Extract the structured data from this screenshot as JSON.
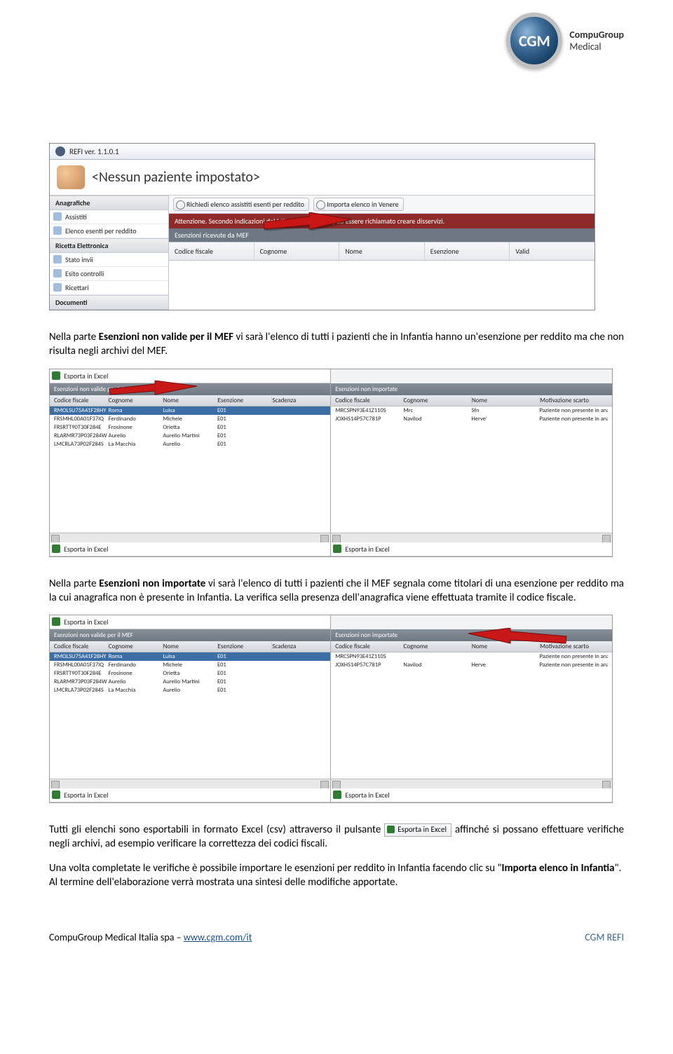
{
  "logo": {
    "abbr": "CGM",
    "line1": "CompuGroup",
    "line2": "Medical"
  },
  "screenshot1": {
    "title": "REFI ver. 1.1.0.1",
    "patient_title": "<Nessun paziente impostato>",
    "sidebar": {
      "grp1": "Anagrafiche",
      "itm1": "Assistiti",
      "itm2": "Elenco esenti per reddito",
      "grp2": "Ricetta Elettronica",
      "itm3": "Stato invii",
      "itm4": "Esito controlli",
      "itm5": "Ricettari",
      "grp3": "Documenti"
    },
    "toolbar": {
      "btn1": "Richiedi elenco assistiti esenti per reddito",
      "btn2": "Importa elenco in Venere"
    },
    "warning": "Attenzione. Secondo indicazioni del MEF, il servizio non può essere richiamato creare disservizi.",
    "subbar": "Esenzioni ricevute da MEF",
    "cols": {
      "c1": "Codice fiscale",
      "c2": "Cognome",
      "c3": "Nome",
      "c4": "Esenzione",
      "c5": "Valid"
    }
  },
  "para1": {
    "p1a": "Nella parte ",
    "p1b": "Esenzioni non valide per il MEF",
    "p1c": " vi sarà l'elenco di tutti i pazienti che in Infantia hanno un'esenzione per reddito ma che non risulta negli archivi del MEF."
  },
  "screenshot2": {
    "export": "Esporta in Excel",
    "left_title": "Esenzioni non valide per MEF",
    "right_title": "Esenzioni non importate",
    "cols_left": {
      "c1": "Codice fiscale",
      "c2": "Cognome",
      "c3": "Nome",
      "c4": "Esenzione",
      "c5": "Scadenza"
    },
    "cols_right": {
      "c1": "Codice fiscale",
      "c2": "Cognome",
      "c3": "Nome",
      "c4": "Motivazione scarto"
    },
    "rows_left": [
      {
        "cf": "RMOLSU75A41F28HY",
        "cog": "Roma",
        "nome": "Luisa",
        "es": "E01",
        "sc": ""
      },
      {
        "cf": "FRSMHL00A01F37IQ",
        "cog": "Ferdinando",
        "nome": "Michele",
        "es": "E01",
        "sc": ""
      },
      {
        "cf": "FRSRTT90T30F284E",
        "cog": "Frosinone",
        "nome": "Orietta",
        "es": "E01",
        "sc": ""
      },
      {
        "cf": "RLARMR73P03F284W",
        "cog": "Aurelio",
        "nome": "Aurelio Martini",
        "es": "E01",
        "sc": ""
      },
      {
        "cf": "LMCRLA73P02F284S",
        "cog": "La Macchia",
        "nome": "Aurelio",
        "es": "E01",
        "sc": ""
      }
    ],
    "rows_right": [
      {
        "cf": "MRCSPN93E41Z110S",
        "cog": "Mrc",
        "nome": "Sfn",
        "mot": "Paziente non presente in anag"
      },
      {
        "cf": "JOXHS14P57C781P",
        "cog": "Navilod",
        "nome": "Herve'",
        "mot": "Paziente non presente in anag"
      }
    ]
  },
  "para2": {
    "p2a": "Nella parte ",
    "p2b": "Esenzioni non importate",
    "p2c": " vi sarà l'elenco di tutti i pazienti che il MEF segnala come titolari di una esenzione per reddito ma la cui anagrafica non è presente in Infantia. La verifica sella presenza dell'anagrafica viene effettuata tramite il codice fiscale."
  },
  "screenshot3": {
    "export": "Esporta in Excel",
    "left_title": "Esenzioni non valide per il MEF",
    "right_title": "Esenzioni non importate",
    "cols_left": {
      "c1": "Codice fiscale",
      "c2": "Cognome",
      "c3": "Nome",
      "c4": "Esenzione",
      "c5": "Scadenza"
    },
    "cols_right": {
      "c1": "Codice fiscale",
      "c2": "Cognome",
      "c3": "Nome",
      "c4": "Motivazione scarto"
    },
    "rows_left": [
      {
        "cf": "RMOLSU75A41F28HY",
        "cog": "Roma",
        "nome": "Luisa",
        "es": "E01",
        "sc": ""
      },
      {
        "cf": "FRSMHL00A01F37IQ",
        "cog": "Ferdinando",
        "nome": "Michele",
        "es": "E01",
        "sc": ""
      },
      {
        "cf": "FRSRTT90T30F284E",
        "cog": "Frosinone",
        "nome": "Orietta",
        "es": "E01",
        "sc": ""
      },
      {
        "cf": "RLARMR73P03F284W",
        "cog": "Aurelio",
        "nome": "Aurelio Martini",
        "es": "E01",
        "sc": ""
      },
      {
        "cf": "LMCRLA73P02F284S",
        "cog": "La Macchia",
        "nome": "Aurelio",
        "es": "E01",
        "sc": ""
      }
    ],
    "rows_right": [
      {
        "cf": "MRCSPN93E41Z110S",
        "cog": "",
        "nome": "",
        "mot": "Paziente non presente in anag"
      },
      {
        "cf": "JOXHS14P57C781P",
        "cog": "Navilod",
        "nome": "Herve",
        "mot": "Paziente non presente in anag"
      }
    ]
  },
  "para3": {
    "p3a": "Tutti gli elenchi sono esportabili in formato Excel (csv) attraverso il pulsante ",
    "inline_btn": "Esporta in Excel",
    "p3b": " affinché si possano effettuare verifiche negli archivi, ad esempio verificare la correttezza dei codici fiscali."
  },
  "para4": {
    "p4a": "Una volta completate le verifiche è possibile importare le esenzioni per reddito in Infantia facendo clic su \"",
    "p4b": "Importa elenco in Infantia",
    "p4c": "\".",
    "p4d": "Al termine dell'elaborazione verrà mostrata una sintesi delle modifiche apportate."
  },
  "footer": {
    "left_text": "CompuGroup Medical Italia spa – ",
    "link": "www.cgm.com/it",
    "right": "CGM REFI"
  }
}
